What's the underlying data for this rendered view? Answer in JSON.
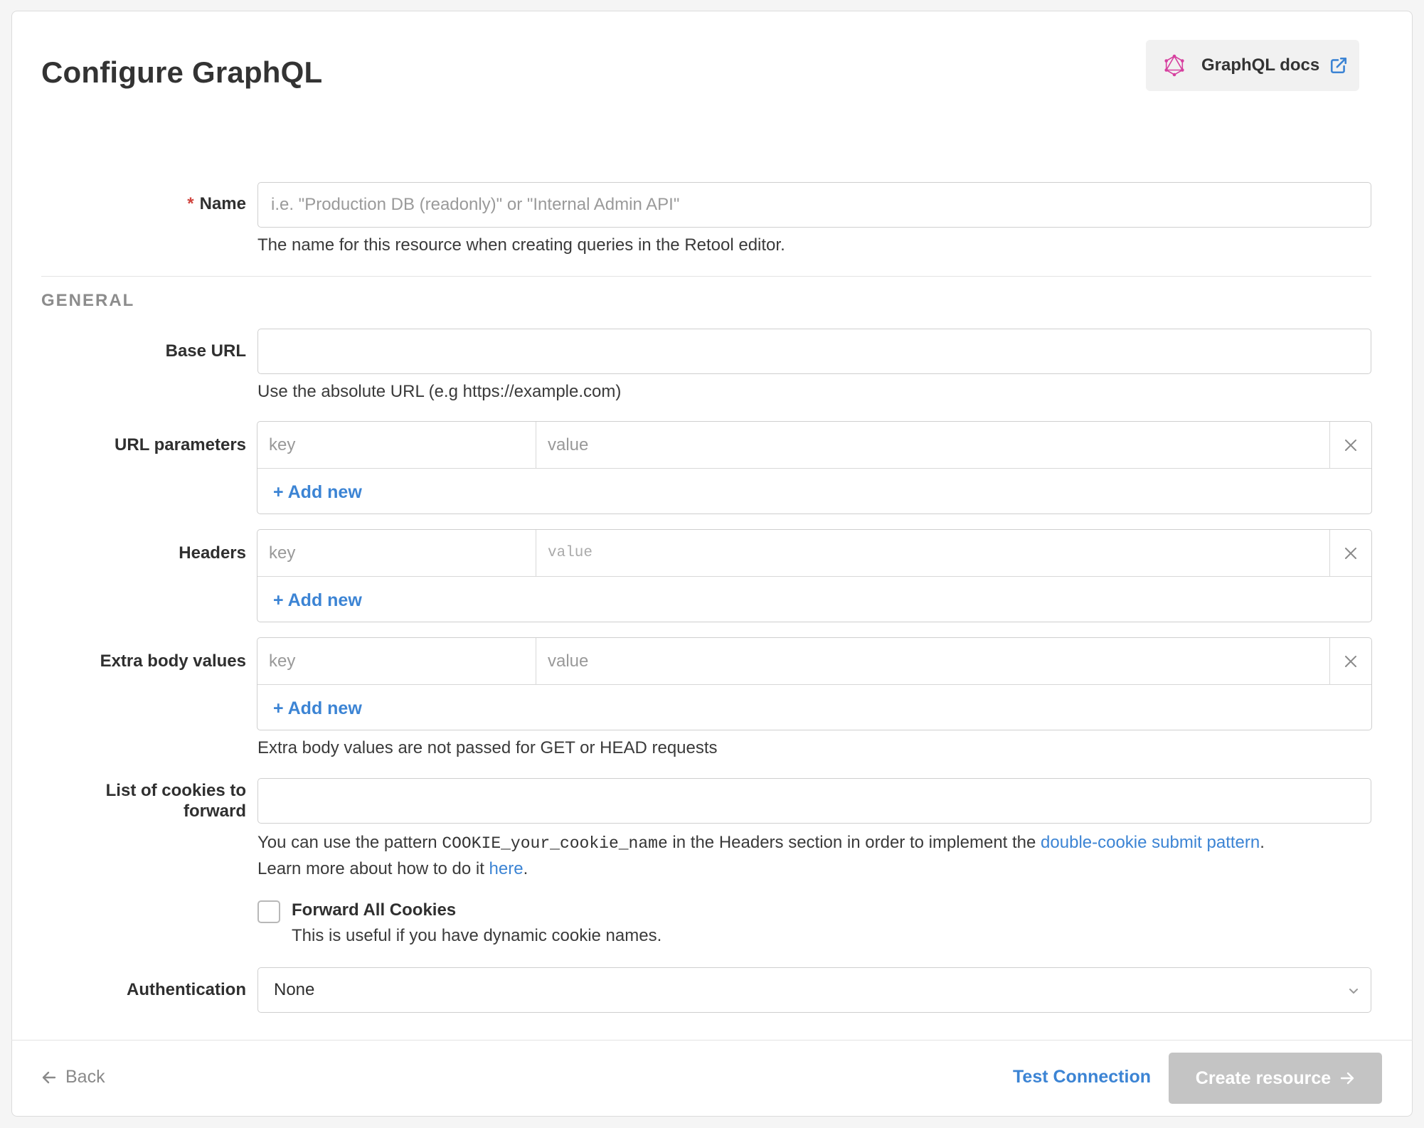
{
  "page": {
    "title": "Configure GraphQL",
    "docs_button": {
      "label": "GraphQL docs",
      "icon": "graphql-logo-icon",
      "ext_icon": "external-link-icon"
    }
  },
  "name_field": {
    "label": "Name",
    "required_mark": "*",
    "placeholder": "i.e. \"Production DB (readonly)\" or \"Internal Admin API\"",
    "value": "",
    "help": "The name for this resource when creating queries in the Retool editor."
  },
  "general": {
    "section_title": "GENERAL",
    "base_url": {
      "label": "Base URL",
      "value": "",
      "help": "Use the absolute URL (e.g https://example.com)"
    },
    "url_parameters": {
      "label": "URL parameters",
      "key_placeholder": "key",
      "value_placeholder": "value",
      "add_label": "+ Add new"
    },
    "headers": {
      "label": "Headers",
      "key_placeholder": "key",
      "value_placeholder": "value",
      "add_label": "+ Add new"
    },
    "extra_body": {
      "label": "Extra body values",
      "key_placeholder": "key",
      "value_placeholder": "value",
      "add_label": "+ Add new",
      "help": "Extra body values are not passed for GET or HEAD requests"
    },
    "cookies": {
      "label_line1": "List of cookies to",
      "label_line2": "forward",
      "value": "",
      "help_prefix": "You can use the pattern ",
      "help_code": "COOKIE_your_cookie_name",
      "help_middle": " in the Headers section in order to implement the ",
      "help_link": "double-cookie submit pattern",
      "help_end": ".",
      "help2_prefix": "Learn more about how to do it ",
      "help2_link": "here",
      "help2_end": "."
    },
    "forward_all": {
      "label": "Forward All Cookies",
      "help": "This is useful if you have dynamic cookie names.",
      "checked": false
    },
    "authentication": {
      "label": "Authentication",
      "selected": "None"
    }
  },
  "footer": {
    "back_label": "Back",
    "test_label": "Test Connection",
    "create_label": "Create resource"
  },
  "colors": {
    "accent": "#3c84d4",
    "required": "#d0443e",
    "disabled_button": "#c4c4c4",
    "graphql_pink": "#d6409f"
  }
}
